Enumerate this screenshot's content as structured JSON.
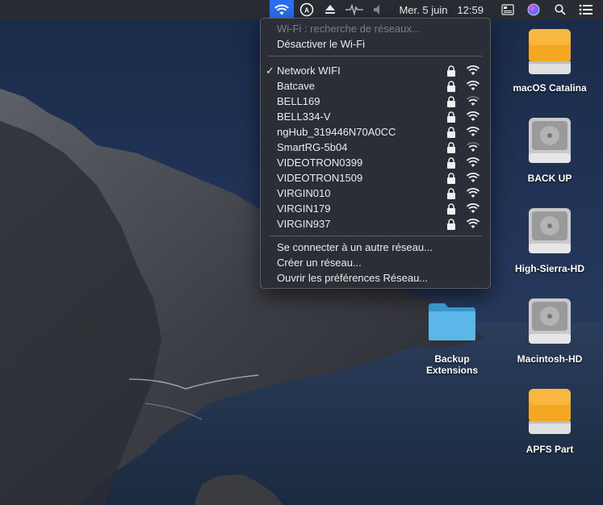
{
  "menubar": {
    "date": "Mer. 5 juin",
    "time": "12:59"
  },
  "wifi_menu": {
    "status": "Wi-Fi : recherche de réseaux...",
    "toggle": "Désactiver le Wi-Fi",
    "networks": [
      {
        "name": "Network WIFI",
        "connected": true,
        "locked": true,
        "signal": 3
      },
      {
        "name": "Batcave",
        "connected": false,
        "locked": true,
        "signal": 3
      },
      {
        "name": "BELL169",
        "connected": false,
        "locked": true,
        "signal": 1
      },
      {
        "name": "BELL334-V",
        "connected": false,
        "locked": true,
        "signal": 3
      },
      {
        "name": "ngHub_319446N70A0CC",
        "connected": false,
        "locked": true,
        "signal": 2
      },
      {
        "name": "SmartRG-5b04",
        "connected": false,
        "locked": true,
        "signal": 1
      },
      {
        "name": "VIDEOTRON0399",
        "connected": false,
        "locked": true,
        "signal": 2
      },
      {
        "name": "VIDEOTRON1509",
        "connected": false,
        "locked": true,
        "signal": 3
      },
      {
        "name": "VIRGIN010",
        "connected": false,
        "locked": true,
        "signal": 3
      },
      {
        "name": "VIRGIN179",
        "connected": false,
        "locked": true,
        "signal": 2
      },
      {
        "name": "VIRGIN937",
        "connected": false,
        "locked": true,
        "signal": 2
      }
    ],
    "actions": [
      "Se connecter à un autre réseau...",
      "Créer un réseau...",
      "Ouvrir les préférences Réseau..."
    ]
  },
  "desktop_icons": [
    {
      "label": "macOS Catalina",
      "kind": "orange-drive"
    },
    {
      "label": "BACK UP",
      "kind": "gray-drive"
    },
    {
      "label": "High-Sierra-HD",
      "kind": "gray-drive"
    },
    {
      "label": "Backup Extensions",
      "kind": "folder"
    },
    {
      "label": "Macintosh-HD",
      "kind": "gray-drive"
    },
    {
      "label": "APFS Part",
      "kind": "orange-drive"
    }
  ],
  "colors": {
    "menubar_bg": "#2a2c32",
    "wifi_highlight": "#2a6ff0",
    "menu_bg": "#2c2e36",
    "orange_drive": "#f5a623",
    "folder": "#5ab7e8"
  }
}
